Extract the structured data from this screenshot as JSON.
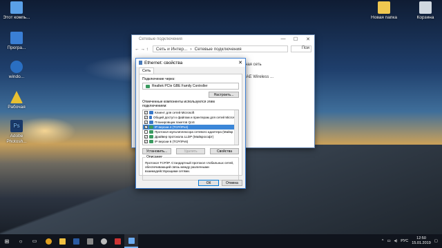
{
  "desktop": {
    "icons_left": [
      {
        "label": "Этот компь...",
        "icon": "computer-icon",
        "color": "#5aa0e8"
      },
      {
        "label": "Програ...",
        "icon": "programs-icon",
        "color": "#3a7fd5"
      },
      {
        "label": "windo...",
        "icon": "windows-icon",
        "color": "#2a6fc2"
      },
      {
        "label": "Рабочая",
        "icon": "warning-icon",
        "color": "#e8c030"
      },
      {
        "label": "Adobe Photosh...",
        "icon": "photoshop-icon",
        "color": "#1a3a6a"
      }
    ],
    "icons_right": [
      {
        "label": "Новая папка",
        "icon": "folder-icon",
        "color": "#f0c850"
      },
      {
        "label": "Корзина",
        "icon": "recycle-bin-icon",
        "color": "#d0d8e0"
      }
    ]
  },
  "explorer": {
    "title": "Сетевые подключения",
    "minimize": "—",
    "maximize": "☐",
    "close": "✕",
    "path": [
      "Сеть и Интер...",
      "Сетевые подключения"
    ],
    "search": "Пои",
    "right_items": [
      "ная сеть",
      "IAE Wireless ..."
    ]
  },
  "dialog": {
    "title": "Ethernet: свойства",
    "close": "✕",
    "tab": "Сеть",
    "connect_using_label": "Подключение через:",
    "adapter_name": "Realtek PCIe GBE Family Controller",
    "configure_button": "Настроить...",
    "components_label": "Отмеченные компоненты используются этим подключением:",
    "components": [
      {
        "checked": true,
        "label": "Клиент для сетей Microsoft",
        "color": "#3a78c8",
        "selected": false
      },
      {
        "checked": true,
        "label": "Общий доступ к файлам и принтерам для сетей Microsoft",
        "color": "#3a78c8",
        "selected": false
      },
      {
        "checked": true,
        "label": "Планировщик пакетов QoS",
        "color": "#3a78c8",
        "selected": false
      },
      {
        "checked": true,
        "label": "IP версии 4 (TCP/IPv4)",
        "color": "#3a9a60",
        "selected": true
      },
      {
        "checked": false,
        "label": "Протокол мультиплексора сетевого адаптера (Майкр",
        "color": "#3a9a60",
        "selected": false
      },
      {
        "checked": true,
        "label": "Драйвер протокола LLDP (Майкрософт)",
        "color": "#3a9a60",
        "selected": false
      },
      {
        "checked": true,
        "label": "IP версии 6 (TCP/IPv6)",
        "color": "#3a9a60",
        "selected": false
      }
    ],
    "install_button": "Установить...",
    "remove_button": "Удалить",
    "properties_button": "Свойства",
    "description_caption": "Описание",
    "description_text": "Протокол TCP/IP. Стандартный протокол глобальных сетей, обеспечивающий связь между различными взаимодействующими сетями.",
    "ok_button": "ОК",
    "cancel_button": "Отмена"
  },
  "taskbar": {
    "items": [
      {
        "icon": "start-icon",
        "color": "#ffffff"
      },
      {
        "icon": "search-icon",
        "color": "#ffffff"
      },
      {
        "icon": "task-view-icon",
        "color": "#ffffff"
      },
      {
        "icon": "chrome-icon",
        "color": "#e0a020"
      },
      {
        "icon": "file-explorer-icon",
        "color": "#f0c040"
      },
      {
        "icon": "photoshop-icon",
        "color": "#2a5aa0"
      },
      {
        "icon": "media-icon",
        "color": "#888888"
      },
      {
        "icon": "settings-icon",
        "color": "#bbbbbb"
      },
      {
        "icon": "app-icon",
        "color": "#cc3333"
      },
      {
        "icon": "network-window-icon",
        "color": "#6aaaf0"
      }
    ],
    "language": "РУС",
    "time": "12:50",
    "date": "15.01.2019"
  }
}
